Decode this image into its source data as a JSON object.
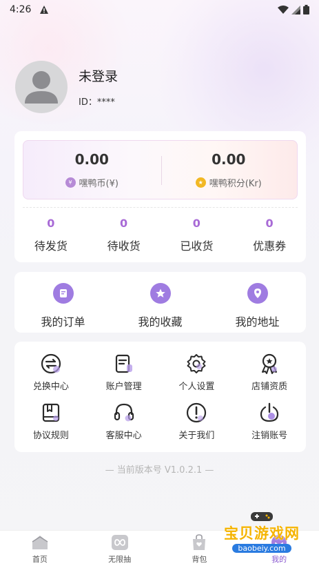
{
  "status_bar": {
    "time": "4:26"
  },
  "profile": {
    "username": "未登录",
    "id_label": "ID：****"
  },
  "wallet": [
    {
      "value": "0.00",
      "label": "嘿鸭币(¥)",
      "icon": "coin-icon",
      "color": "#b68ad6"
    },
    {
      "value": "0.00",
      "label": "嘿鸭积分(Kr)",
      "icon": "points-icon",
      "color": "#f2b824"
    }
  ],
  "orders": [
    {
      "count": "0",
      "label": "待发货"
    },
    {
      "count": "0",
      "label": "待收货"
    },
    {
      "count": "0",
      "label": "已收货"
    },
    {
      "count": "0",
      "label": "优惠券"
    }
  ],
  "quick_links": [
    {
      "label": "我的订单",
      "icon": "order-icon"
    },
    {
      "label": "我的收藏",
      "icon": "favorite-icon"
    },
    {
      "label": "我的地址",
      "icon": "location-icon"
    }
  ],
  "services": [
    {
      "label": "兑换中心",
      "icon": "exchange-icon"
    },
    {
      "label": "账户管理",
      "icon": "account-icon"
    },
    {
      "label": "个人设置",
      "icon": "settings-icon"
    },
    {
      "label": "店铺资质",
      "icon": "badge-icon"
    },
    {
      "label": "协议规则",
      "icon": "agreement-icon"
    },
    {
      "label": "客服中心",
      "icon": "headset-icon"
    },
    {
      "label": "关于我们",
      "icon": "info-icon"
    },
    {
      "label": "注销账号",
      "icon": "power-icon"
    }
  ],
  "version": "— 当前版本号 V1.0.2.1 —",
  "tabbar": [
    {
      "label": "首页",
      "icon": "home-icon"
    },
    {
      "label": "无限抽",
      "icon": "infinity-icon"
    },
    {
      "label": "背包",
      "icon": "bag-icon"
    },
    {
      "label": "我的",
      "icon": "profile-icon",
      "active": true
    }
  ],
  "watermark": {
    "title": "宝贝游戏网",
    "url": "baobeiy.com"
  },
  "colors": {
    "accent": "#9f7ce1",
    "count": "#a86ad6",
    "gold": "#f2b824"
  }
}
